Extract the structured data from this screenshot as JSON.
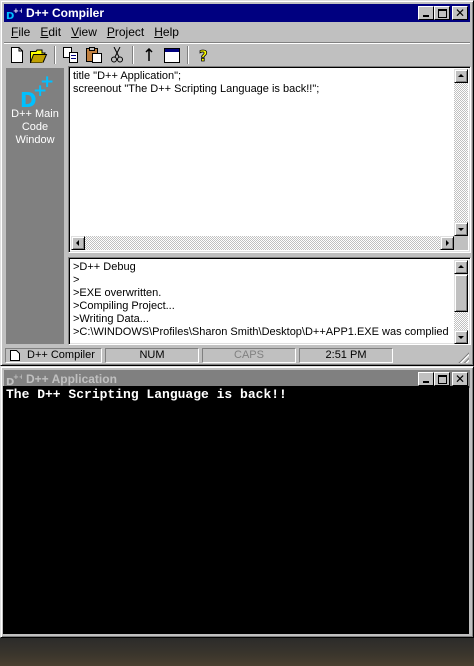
{
  "compiler_window": {
    "title": "D++ Compiler",
    "menu": [
      "File",
      "Edit",
      "View",
      "Project",
      "Help"
    ],
    "menu_hotkeys": [
      "F",
      "E",
      "V",
      "P",
      "H"
    ],
    "toolbar": [
      "new-file-icon",
      "open-folder-icon",
      "copy-icon",
      "paste-icon",
      "cut-icon",
      "up-arrow-icon",
      "window-icon",
      "help-icon"
    ],
    "sidebar": {
      "logo_text": "D++",
      "label": "D++ Main\nCode\nWindow"
    },
    "code_lines": [
      "title \"D++ Application\";",
      "screenout \"The D++ Scripting Language is back!!\";"
    ],
    "debug_lines": [
      ">D++ Debug",
      ">",
      ">EXE overwritten.",
      ">Compiling Project...",
      ">Writing Data...",
      ">C:\\WINDOWS\\Profiles\\Sharon Smith\\Desktop\\D++APP1.EXE was complied"
    ],
    "status": {
      "app": "D++ Compiler",
      "num": "NUM",
      "caps": "CAPS",
      "time": "2:51 PM"
    }
  },
  "app_window": {
    "title": "D++ Application",
    "output": "The D++ Scripting Language is back!!"
  },
  "colors": {
    "active_title": "#000080",
    "inactive_title": "#808080",
    "face": "#c0c0c0",
    "sidebar": "#808080",
    "logo_accent": "#00c0ff",
    "console_bg": "#000000"
  }
}
